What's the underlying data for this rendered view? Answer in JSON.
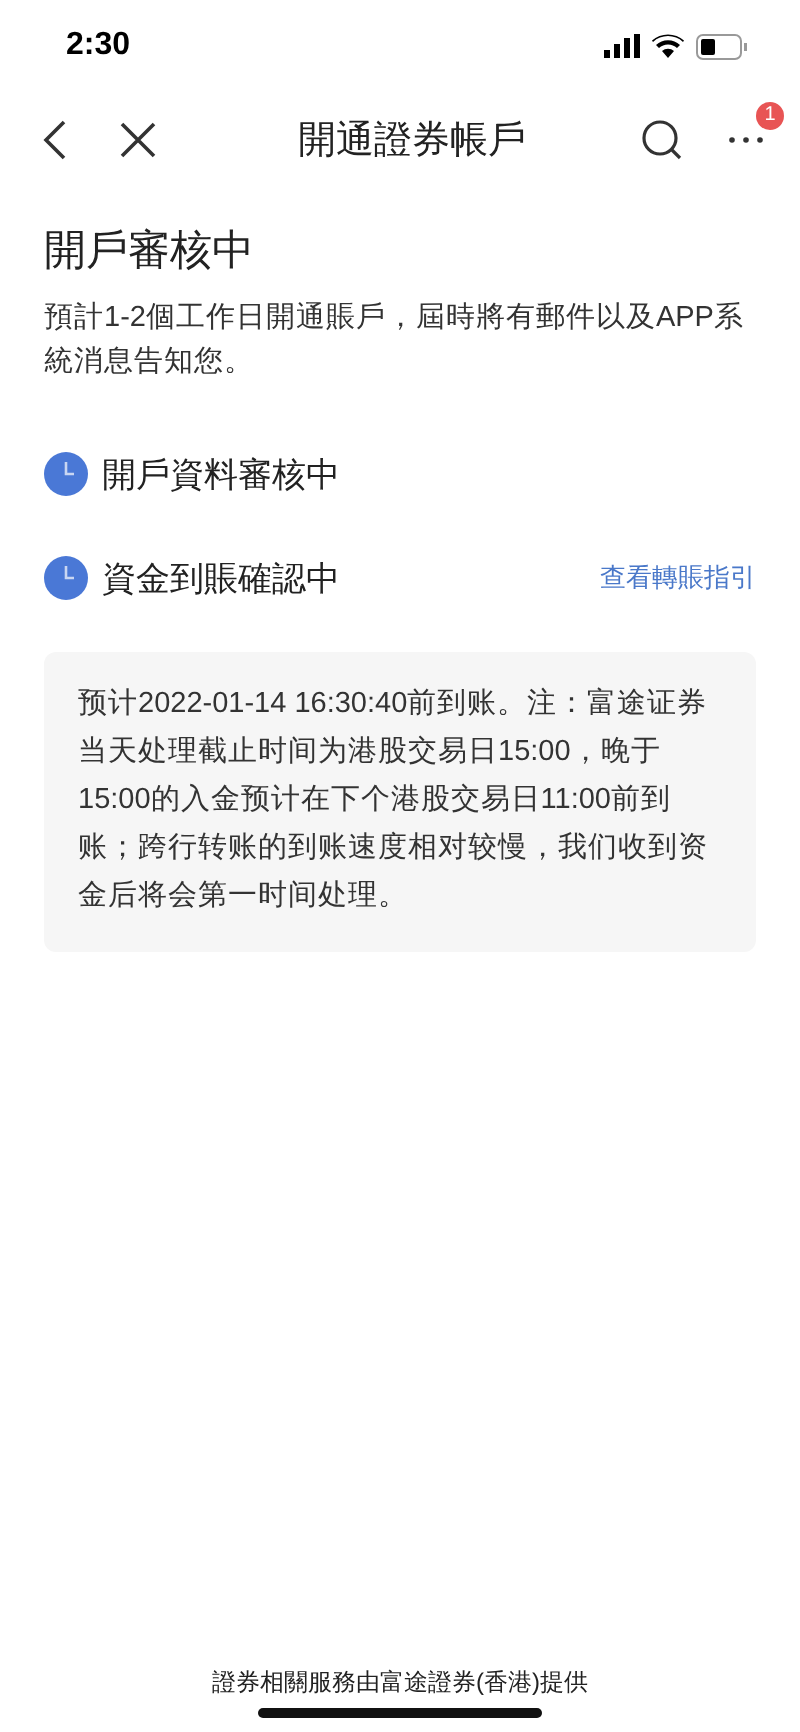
{
  "status_bar": {
    "time": "2:30"
  },
  "nav": {
    "title": "開通證券帳戶",
    "more_badge": "1"
  },
  "heading": "開戶審核中",
  "description": "預計1-2個工作日開通賬戶，屆時將有郵件以及APP系統消息告知您。",
  "steps": [
    {
      "label": "開戶資料審核中"
    },
    {
      "label": "資金到賬確認中",
      "link": "查看轉賬指引"
    }
  ],
  "notice": "预计2022-01-14 16:30:40前到账。注：富途证券当天处理截止时间为港股交易日15:00，晚于15:00的入金预计在下个港股交易日11:00前到账；跨行转账的到账速度相对较慢，我们收到资金后将会第一时间处理。",
  "footer": "證券相關服務由富途證券(香港)提供"
}
